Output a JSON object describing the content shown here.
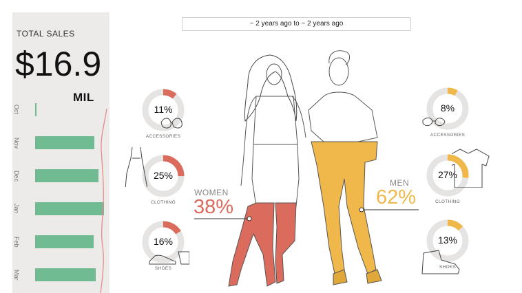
{
  "sidebar": {
    "title": "TOTAL SALES",
    "value": "$16.9",
    "unit": "MIL",
    "months": [
      {
        "label": "Oct",
        "value": 0.02
      },
      {
        "label": "Nov",
        "value": 0.86
      },
      {
        "label": "Dec",
        "value": 0.92
      },
      {
        "label": "Jan",
        "value": 1.0
      },
      {
        "label": "Feb",
        "value": 0.85
      },
      {
        "label": "Mar",
        "value": 0.88
      }
    ],
    "bar_color": "#71bb92",
    "trend_color": "#e58a8a"
  },
  "filter": {
    "label": "~ 2 years ago to ~ 2 years ago"
  },
  "women": {
    "label": "WOMEN",
    "pct": "38%",
    "color": "#db6b5c",
    "categories": [
      {
        "name": "ACCESSORIES",
        "pct": "11%",
        "value": 0.11
      },
      {
        "name": "CLOTHING",
        "pct": "25%",
        "value": 0.25
      },
      {
        "name": "SHOES",
        "pct": "16%",
        "value": 0.16
      }
    ]
  },
  "men": {
    "label": "MEN",
    "pct": "62%",
    "color": "#f0b84a",
    "categories": [
      {
        "name": "ACCESSORIES",
        "pct": "8%",
        "value": 0.08
      },
      {
        "name": "CLOTHING",
        "pct": "27%",
        "value": 0.27
      },
      {
        "name": "SHOES",
        "pct": "13%",
        "value": 0.13
      }
    ]
  },
  "icons": {
    "women": [
      "sunglasses-icon",
      "dress-icon",
      "sandal-icon"
    ],
    "men": [
      "sunglasses-icon",
      "shirt-icon",
      "boot-icon"
    ]
  }
}
